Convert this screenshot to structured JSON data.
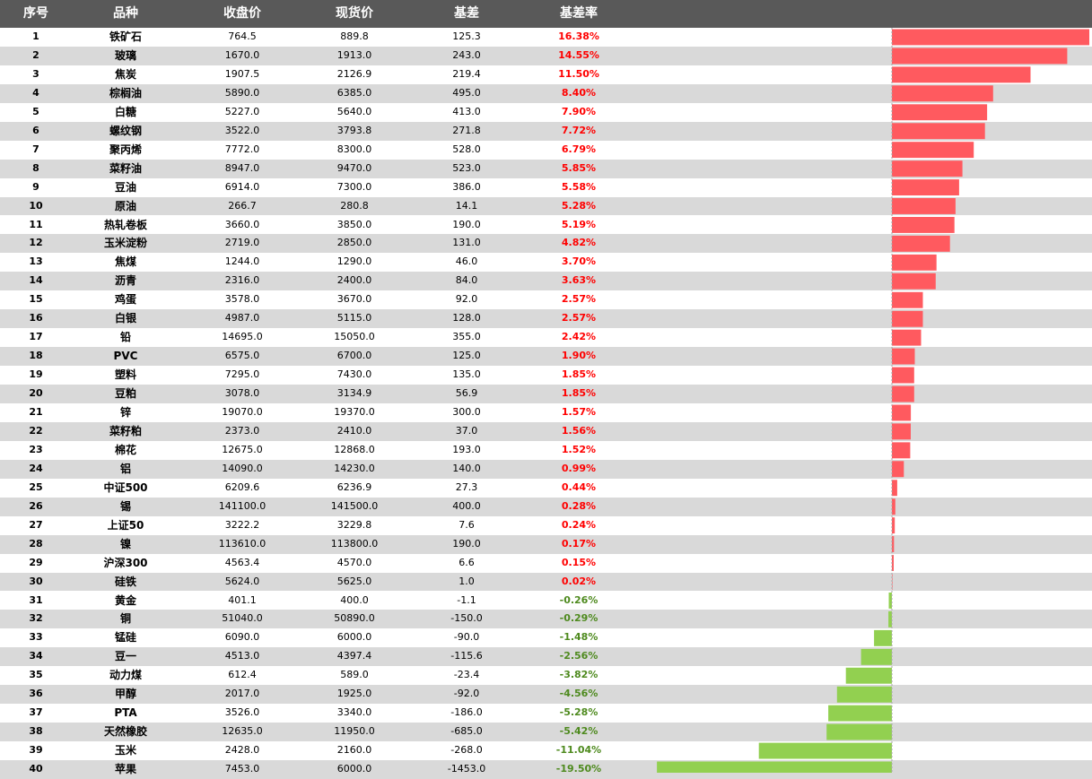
{
  "header": {
    "col_index": "序号",
    "col_name": "品种",
    "col_close": "收盘价",
    "col_spot": "现货价",
    "col_basis": "基差",
    "col_rate": "基差率"
  },
  "colors": {
    "header_bg": "#595959",
    "stripe": "#d9d9d9",
    "positive_bar": "#ff5a5f",
    "negative_bar": "#92d050",
    "positive_text": "#ff0000",
    "negative_text": "#4e8a1e"
  },
  "chart_data": {
    "type": "bar",
    "orientation": "horizontal",
    "series": [
      {
        "name": "基差率",
        "unit": "%"
      }
    ],
    "rows": [
      {
        "idx": "1",
        "name": "铁矿石",
        "close": "764.5",
        "spot": "889.8",
        "basis": "125.3",
        "rate_label": "16.38%",
        "rate": 16.38
      },
      {
        "idx": "2",
        "name": "玻璃",
        "close": "1670.0",
        "spot": "1913.0",
        "basis": "243.0",
        "rate_label": "14.55%",
        "rate": 14.55
      },
      {
        "idx": "3",
        "name": "焦炭",
        "close": "1907.5",
        "spot": "2126.9",
        "basis": "219.4",
        "rate_label": "11.50%",
        "rate": 11.5
      },
      {
        "idx": "4",
        "name": "棕榈油",
        "close": "5890.0",
        "spot": "6385.0",
        "basis": "495.0",
        "rate_label": "8.40%",
        "rate": 8.4
      },
      {
        "idx": "5",
        "name": "白糖",
        "close": "5227.0",
        "spot": "5640.0",
        "basis": "413.0",
        "rate_label": "7.90%",
        "rate": 7.9
      },
      {
        "idx": "6",
        "name": "螺纹钢",
        "close": "3522.0",
        "spot": "3793.8",
        "basis": "271.8",
        "rate_label": "7.72%",
        "rate": 7.72
      },
      {
        "idx": "7",
        "name": "聚丙烯",
        "close": "7772.0",
        "spot": "8300.0",
        "basis": "528.0",
        "rate_label": "6.79%",
        "rate": 6.79
      },
      {
        "idx": "8",
        "name": "菜籽油",
        "close": "8947.0",
        "spot": "9470.0",
        "basis": "523.0",
        "rate_label": "5.85%",
        "rate": 5.85
      },
      {
        "idx": "9",
        "name": "豆油",
        "close": "6914.0",
        "spot": "7300.0",
        "basis": "386.0",
        "rate_label": "5.58%",
        "rate": 5.58
      },
      {
        "idx": "10",
        "name": "原油",
        "close": "266.7",
        "spot": "280.8",
        "basis": "14.1",
        "rate_label": "5.28%",
        "rate": 5.28
      },
      {
        "idx": "11",
        "name": "热轧卷板",
        "close": "3660.0",
        "spot": "3850.0",
        "basis": "190.0",
        "rate_label": "5.19%",
        "rate": 5.19
      },
      {
        "idx": "12",
        "name": "玉米淀粉",
        "close": "2719.0",
        "spot": "2850.0",
        "basis": "131.0",
        "rate_label": "4.82%",
        "rate": 4.82
      },
      {
        "idx": "13",
        "name": "焦煤",
        "close": "1244.0",
        "spot": "1290.0",
        "basis": "46.0",
        "rate_label": "3.70%",
        "rate": 3.7
      },
      {
        "idx": "14",
        "name": "沥青",
        "close": "2316.0",
        "spot": "2400.0",
        "basis": "84.0",
        "rate_label": "3.63%",
        "rate": 3.63
      },
      {
        "idx": "15",
        "name": "鸡蛋",
        "close": "3578.0",
        "spot": "3670.0",
        "basis": "92.0",
        "rate_label": "2.57%",
        "rate": 2.57
      },
      {
        "idx": "16",
        "name": "白银",
        "close": "4987.0",
        "spot": "5115.0",
        "basis": "128.0",
        "rate_label": "2.57%",
        "rate": 2.57
      },
      {
        "idx": "17",
        "name": "铅",
        "close": "14695.0",
        "spot": "15050.0",
        "basis": "355.0",
        "rate_label": "2.42%",
        "rate": 2.42
      },
      {
        "idx": "18",
        "name": "PVC",
        "close": "6575.0",
        "spot": "6700.0",
        "basis": "125.0",
        "rate_label": "1.90%",
        "rate": 1.9
      },
      {
        "idx": "19",
        "name": "塑料",
        "close": "7295.0",
        "spot": "7430.0",
        "basis": "135.0",
        "rate_label": "1.85%",
        "rate": 1.85
      },
      {
        "idx": "20",
        "name": "豆粕",
        "close": "3078.0",
        "spot": "3134.9",
        "basis": "56.9",
        "rate_label": "1.85%",
        "rate": 1.85
      },
      {
        "idx": "21",
        "name": "锌",
        "close": "19070.0",
        "spot": "19370.0",
        "basis": "300.0",
        "rate_label": "1.57%",
        "rate": 1.57
      },
      {
        "idx": "22",
        "name": "菜籽粕",
        "close": "2373.0",
        "spot": "2410.0",
        "basis": "37.0",
        "rate_label": "1.56%",
        "rate": 1.56
      },
      {
        "idx": "23",
        "name": "棉花",
        "close": "12675.0",
        "spot": "12868.0",
        "basis": "193.0",
        "rate_label": "1.52%",
        "rate": 1.52
      },
      {
        "idx": "24",
        "name": "铝",
        "close": "14090.0",
        "spot": "14230.0",
        "basis": "140.0",
        "rate_label": "0.99%",
        "rate": 0.99
      },
      {
        "idx": "25",
        "name": "中证500",
        "close": "6209.6",
        "spot": "6236.9",
        "basis": "27.3",
        "rate_label": "0.44%",
        "rate": 0.44
      },
      {
        "idx": "26",
        "name": "锡",
        "close": "141100.0",
        "spot": "141500.0",
        "basis": "400.0",
        "rate_label": "0.28%",
        "rate": 0.28
      },
      {
        "idx": "27",
        "name": "上证50",
        "close": "3222.2",
        "spot": "3229.8",
        "basis": "7.6",
        "rate_label": "0.24%",
        "rate": 0.24
      },
      {
        "idx": "28",
        "name": "镍",
        "close": "113610.0",
        "spot": "113800.0",
        "basis": "190.0",
        "rate_label": "0.17%",
        "rate": 0.17
      },
      {
        "idx": "29",
        "name": "沪深300",
        "close": "4563.4",
        "spot": "4570.0",
        "basis": "6.6",
        "rate_label": "0.15%",
        "rate": 0.15
      },
      {
        "idx": "30",
        "name": "硅铁",
        "close": "5624.0",
        "spot": "5625.0",
        "basis": "1.0",
        "rate_label": "0.02%",
        "rate": 0.02
      },
      {
        "idx": "31",
        "name": "黄金",
        "close": "401.1",
        "spot": "400.0",
        "basis": "-1.1",
        "rate_label": "-0.26%",
        "rate": -0.26
      },
      {
        "idx": "32",
        "name": "铜",
        "close": "51040.0",
        "spot": "50890.0",
        "basis": "-150.0",
        "rate_label": "-0.29%",
        "rate": -0.29
      },
      {
        "idx": "33",
        "name": "锰硅",
        "close": "6090.0",
        "spot": "6000.0",
        "basis": "-90.0",
        "rate_label": "-1.48%",
        "rate": -1.48
      },
      {
        "idx": "34",
        "name": "豆一",
        "close": "4513.0",
        "spot": "4397.4",
        "basis": "-115.6",
        "rate_label": "-2.56%",
        "rate": -2.56
      },
      {
        "idx": "35",
        "name": "动力煤",
        "close": "612.4",
        "spot": "589.0",
        "basis": "-23.4",
        "rate_label": "-3.82%",
        "rate": -3.82
      },
      {
        "idx": "36",
        "name": "甲醇",
        "close": "2017.0",
        "spot": "1925.0",
        "basis": "-92.0",
        "rate_label": "-4.56%",
        "rate": -4.56
      },
      {
        "idx": "37",
        "name": "PTA",
        "close": "3526.0",
        "spot": "3340.0",
        "basis": "-186.0",
        "rate_label": "-5.28%",
        "rate": -5.28
      },
      {
        "idx": "38",
        "name": "天然橡胶",
        "close": "12635.0",
        "spot": "11950.0",
        "basis": "-685.0",
        "rate_label": "-5.42%",
        "rate": -5.42
      },
      {
        "idx": "39",
        "name": "玉米",
        "close": "2428.0",
        "spot": "2160.0",
        "basis": "-268.0",
        "rate_label": "-11.04%",
        "rate": -11.04
      },
      {
        "idx": "40",
        "name": "苹果",
        "close": "7453.0",
        "spot": "6000.0",
        "basis": "-1453.0",
        "rate_label": "-19.50%",
        "rate": -19.5
      }
    ],
    "xlim": [
      -19.5,
      16.38
    ],
    "zero_line": "dotted"
  }
}
